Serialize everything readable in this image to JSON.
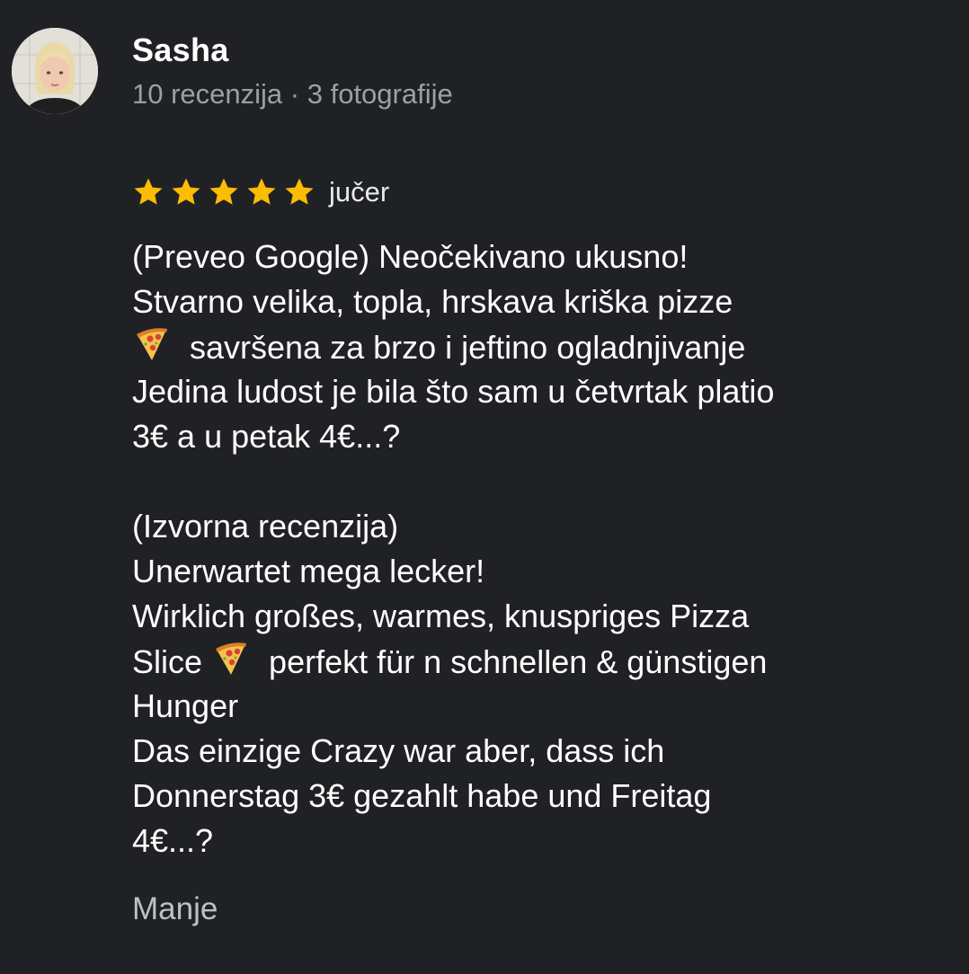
{
  "reviewer": {
    "name": "Sasha",
    "reviews_count_label": "10 recenzija",
    "separator": "·",
    "photos_count_label": "3 fotografije"
  },
  "review": {
    "rating": 5,
    "rating_max": 5,
    "star_color": "#fbbc04",
    "date": "jučer",
    "translated": {
      "lines": [
        "(Preveo Google) Neočekivano ukusno!",
        "Stvarno velika, topla, hrskava kriška pizze",
        "savršena za brzo i jeftino ogladnjivanje",
        "Jedina ludost je bila što sam u četvrtak platio",
        "3€ a u petak 4€...?"
      ]
    },
    "original": {
      "lines": [
        "(Izvorna recenzija)",
        "Unerwartet mega lecker!",
        "Wirklich großes, warmes, knuspriges Pizza",
        "Slice",
        "perfekt für n schnellen & günstigen",
        "Hunger",
        "Das einzige Crazy war aber, dass ich",
        "Donnerstag 3€ gezahlt habe und Freitag",
        "4€...?"
      ]
    },
    "emoji_icon": "pizza-slice-icon"
  },
  "actions": {
    "less_label": "Manje"
  }
}
